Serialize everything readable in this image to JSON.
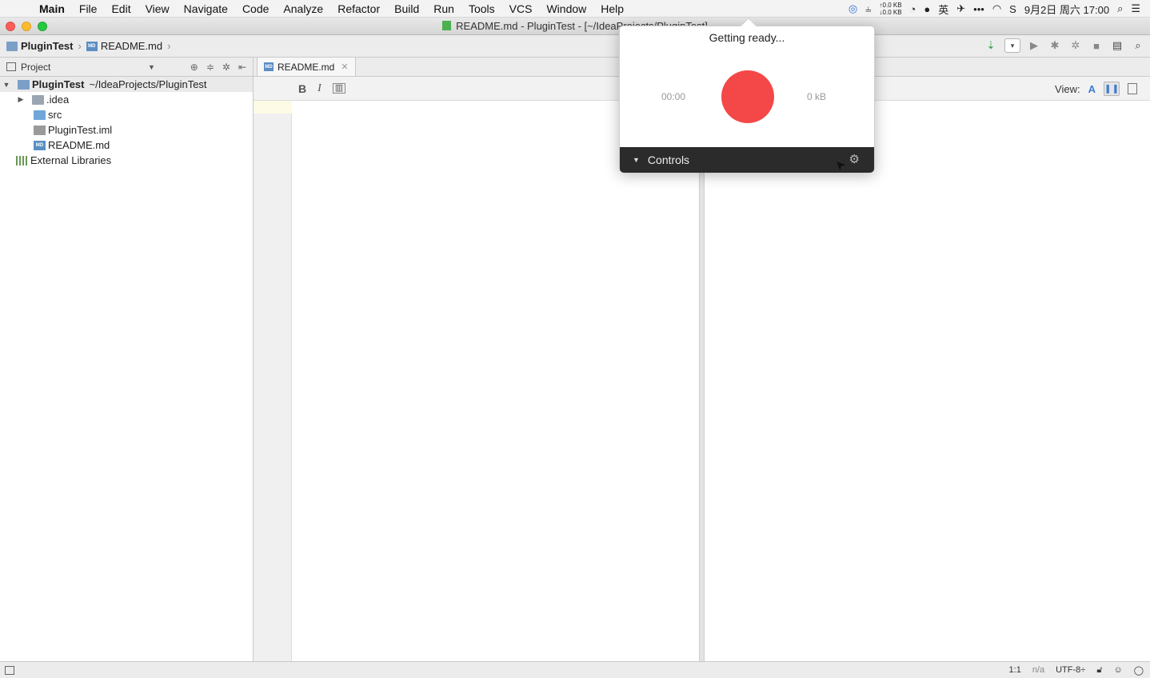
{
  "menubar": {
    "app": "Main",
    "items": [
      "File",
      "Edit",
      "View",
      "Navigate",
      "Code",
      "Analyze",
      "Refactor",
      "Build",
      "Run",
      "Tools",
      "VCS",
      "Window",
      "Help"
    ],
    "net_up": "↑0.0 KB",
    "net_down": "↓0.0 KB",
    "ime": "英",
    "datetime": "9月2日 周六 17:00"
  },
  "window": {
    "title": "README.md - PluginTest - [~/IdeaProjects/PluginTest]"
  },
  "navbar": {
    "crumbs": [
      "PluginTest",
      "README.md"
    ]
  },
  "project_panel": {
    "header": "Project",
    "root_name": "PluginTest",
    "root_path": "~/IdeaProjects/PluginTest",
    "children": [
      ".idea",
      "src",
      "PluginTest.iml",
      "README.md"
    ],
    "external": "External Libraries"
  },
  "editor": {
    "tab_label": "README.md",
    "format_bold": "B",
    "format_italic": "I",
    "view_label": "View:",
    "view_mode_text": "A"
  },
  "statusbar": {
    "position": "1:1",
    "na": "n/a",
    "encoding": "UTF-8÷"
  },
  "recorder": {
    "status": "Getting ready...",
    "time": "00:00",
    "size": "0 kB",
    "controls_label": "Controls"
  },
  "colors": {
    "record": "#f44747",
    "controls_bar": "#2b2b2b"
  }
}
